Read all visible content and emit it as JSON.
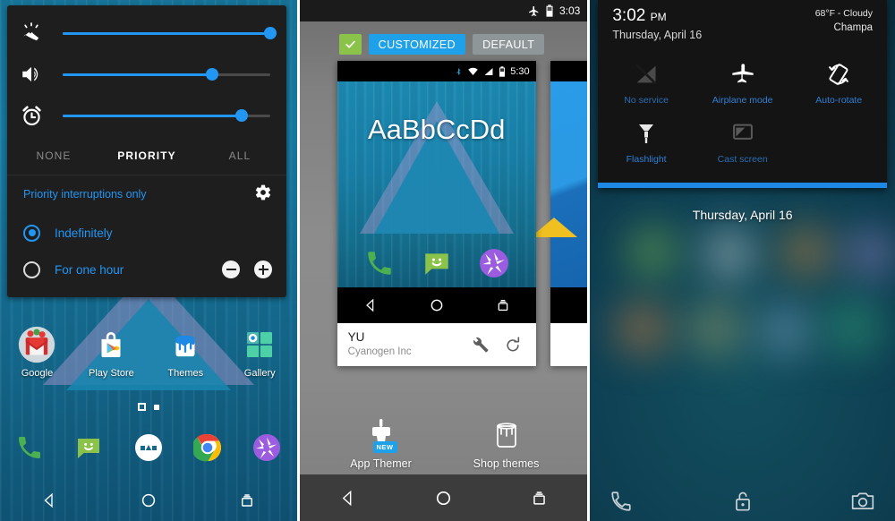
{
  "panel1": {
    "name": "home-screen-with-volume-panel",
    "volume": {
      "sliders": [
        {
          "icon": "ringer-vibrate-icon",
          "level": 100
        },
        {
          "icon": "speaker-volume-icon",
          "level": 72
        },
        {
          "icon": "alarm-clock-icon",
          "level": 86
        }
      ],
      "segments": [
        {
          "label": "NONE",
          "active": false
        },
        {
          "label": "PRIORITY",
          "active": true
        },
        {
          "label": "ALL",
          "active": false
        }
      ],
      "dnd_title": "Priority interruptions only",
      "settings_icon": "gear-icon",
      "options": [
        {
          "label": "Indefinitely",
          "selected": true,
          "has_stepper": false
        },
        {
          "label": "For one hour",
          "selected": false,
          "has_stepper": true
        }
      ],
      "stepper_minus": "minus-icon",
      "stepper_plus": "plus-icon"
    },
    "apps": [
      {
        "label": "Google",
        "icon": "gmail-icon"
      },
      {
        "label": "Play Store",
        "icon": "play-store-icon"
      },
      {
        "label": "Themes",
        "icon": "themes-bucket-icon"
      },
      {
        "label": "Gallery",
        "icon": "gallery-icon"
      }
    ],
    "page_dots": {
      "current": 1,
      "total": 2
    },
    "dock": [
      {
        "icon": "phone-icon"
      },
      {
        "icon": "messaging-icon"
      },
      {
        "icon": "app-drawer-icon"
      },
      {
        "icon": "chrome-icon"
      },
      {
        "icon": "camera-aperture-icon"
      }
    ],
    "navbar": [
      {
        "icon": "back-icon"
      },
      {
        "icon": "home-icon"
      },
      {
        "icon": "recents-icon"
      }
    ]
  },
  "panel2": {
    "name": "themes-chooser",
    "status_bar": {
      "airplane_icon": "airplane-icon",
      "battery_icon": "battery-icon",
      "time": "3:03"
    },
    "chips": {
      "check_icon": "check-icon",
      "selected": "CUSTOMIZED",
      "unselected": "DEFAULT"
    },
    "theme_card": {
      "status_bar": {
        "bluetooth_icon": "bluetooth-icon",
        "wifi_icon": "wifi-icon",
        "signal_icon": "signal-icon",
        "battery_icon": "battery-icon",
        "time": "5:30"
      },
      "font_sample": "AaBbCcDd",
      "preview_icons": [
        {
          "icon": "phone-icon"
        },
        {
          "icon": "messaging-icon"
        },
        {
          "icon": "camera-aperture-icon"
        }
      ],
      "nav": [
        {
          "icon": "back-icon"
        },
        {
          "icon": "home-icon"
        },
        {
          "icon": "recents-icon"
        }
      ],
      "title": "YU",
      "subtitle": "Cyanogen Inc",
      "actions": [
        {
          "icon": "wrench-icon"
        },
        {
          "icon": "reset-icon"
        }
      ]
    },
    "bottom_actions": [
      {
        "label": "App Themer",
        "icon": "paint-brush-icon",
        "badge": "NEW"
      },
      {
        "label": "Shop themes",
        "icon": "paint-bucket-icon",
        "badge": ""
      }
    ],
    "navbar": [
      {
        "icon": "back-icon"
      },
      {
        "icon": "home-icon"
      },
      {
        "icon": "recents-icon"
      }
    ]
  },
  "panel3": {
    "name": "lockscreen-quick-settings",
    "header": {
      "time": "3:02",
      "time_suffix": "PM",
      "date": "Thursday, April 16",
      "weather": "68°F - Cloudy",
      "location": "Champa"
    },
    "tiles": [
      {
        "label": "No service",
        "icon": "no-signal-icon",
        "enabled": false
      },
      {
        "label": "Airplane mode",
        "icon": "airplane-icon",
        "enabled": true
      },
      {
        "label": "Auto-rotate",
        "icon": "auto-rotate-icon",
        "enabled": true
      },
      {
        "label": "Flashlight",
        "icon": "flashlight-icon",
        "enabled": true
      },
      {
        "label": "Cast screen",
        "icon": "cast-screen-icon",
        "enabled": false
      }
    ],
    "lock_date": "Thursday, April 16",
    "shortcuts": [
      {
        "icon": "phone-icon"
      },
      {
        "icon": "unlock-icon"
      },
      {
        "icon": "camera-icon"
      }
    ]
  },
  "colors": {
    "accent_blue": "#2196f3",
    "chip_blue": "#1ea1e8",
    "check_green": "#8bc34a",
    "tile_label_blue": "#2f7fd4",
    "handle_blue": "#1e88e5"
  }
}
